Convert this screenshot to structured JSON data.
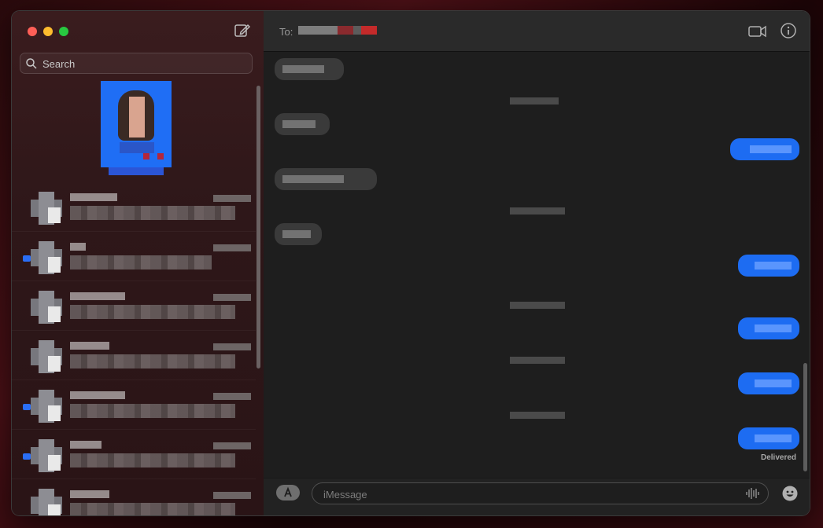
{
  "sidebar": {
    "search_placeholder": "Search",
    "conversations": [
      {
        "name": "▒▒▒▒▒▒",
        "time": "▒▒▒",
        "preview": "▒▒▒▒▒▒▒▒",
        "unread": false
      },
      {
        "name": "▒▒▒▒▒▒",
        "time": "▒▒▒",
        "preview": "▒▒▒▒▒▒▒▒",
        "unread": true
      },
      {
        "name": "▒▒▒▒▒▒",
        "time": "▒▒▒",
        "preview": "▒▒▒▒▒▒▒▒",
        "unread": false
      },
      {
        "name": "▒▒▒▒▒▒",
        "time": "▒▒▒",
        "preview": "▒▒▒▒▒▒▒▒",
        "unread": false
      },
      {
        "name": "▒▒▒▒▒▒",
        "time": "▒▒▒",
        "preview": "▒▒▒▒▒▒▒▒",
        "unread": true
      },
      {
        "name": "▒▒▒▒▒▒",
        "time": "▒▒▒",
        "preview": "▒▒▒▒▒▒▒▒",
        "unread": true
      },
      {
        "name": "▒▒▒▒▒▒",
        "time": "▒▒▒",
        "preview": "▒▒▒▒▒▒▒▒",
        "unread": false
      }
    ]
  },
  "header": {
    "to_label": "To:",
    "recipient": "▒▒▒▒▒▒▒"
  },
  "transcript": {
    "status": "Delivered"
  },
  "composer": {
    "placeholder": "iMessage"
  },
  "colors": {
    "accent": "#1d6cf2",
    "sidebar_bg": "#2e1719",
    "main_bg": "#1e1e1e"
  }
}
